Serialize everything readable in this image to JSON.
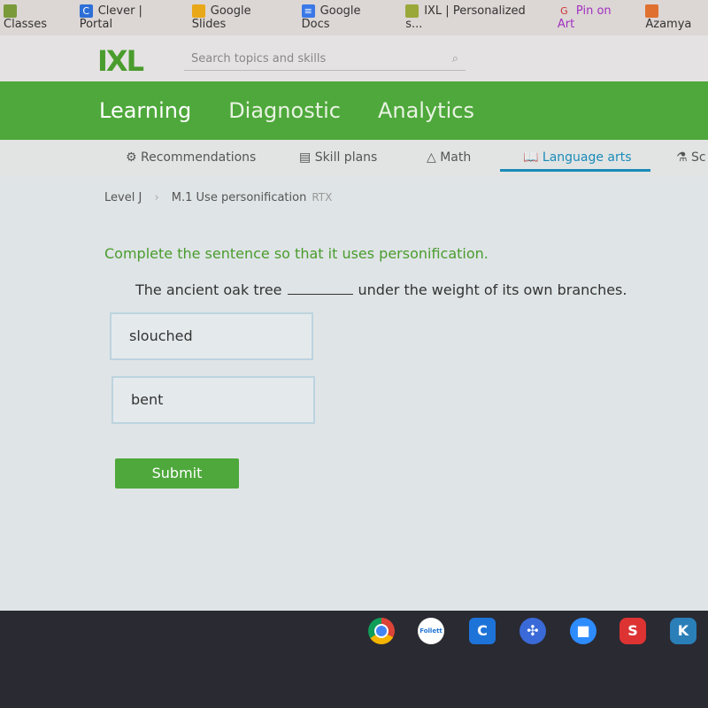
{
  "bookmarks": [
    {
      "label": "Classes",
      "color": "#7a9a3a"
    },
    {
      "label": "Clever | Portal",
      "color": "#2d6fd6"
    },
    {
      "label": "Google Slides",
      "color": "#e8a818"
    },
    {
      "label": "Google Docs",
      "color": "#3b78e7"
    },
    {
      "label": "IXL | Personalized s...",
      "color": "#9aa83a"
    },
    {
      "label": "Pin on Art",
      "color": "#cc3333"
    },
    {
      "label": "Azamya",
      "color": "#e07030"
    }
  ],
  "header": {
    "logo": "IXL",
    "search_placeholder": "Search topics and skills"
  },
  "main_nav": [
    {
      "label": "Learning",
      "active": true
    },
    {
      "label": "Diagnostic"
    },
    {
      "label": "Analytics"
    }
  ],
  "sub_nav": [
    {
      "label": "Recommendations"
    },
    {
      "label": "Skill plans"
    },
    {
      "label": "Math"
    },
    {
      "label": "Language arts",
      "active": true
    },
    {
      "label": "Sc"
    }
  ],
  "breadcrumb": {
    "level": "Level J",
    "skill": "M.1 Use personification",
    "tag": "RTX"
  },
  "question": {
    "prompt": "Complete the sentence so that it uses personification.",
    "before": "The ancient oak tree",
    "after": "under the weight of its own branches.",
    "options": [
      "slouched",
      "bent"
    ],
    "submit": "Submit"
  },
  "taskbar": [
    {
      "label": "",
      "color": "#db4437"
    },
    {
      "label": "Follett",
      "color": "#ffffff"
    },
    {
      "label": "C",
      "color": "#1e73d8"
    },
    {
      "label": "",
      "color": "#3a6ad8"
    },
    {
      "label": "",
      "color": "#2d8cff"
    },
    {
      "label": "",
      "color": "#d33"
    },
    {
      "label": "K",
      "color": "#2a7fb8"
    }
  ]
}
